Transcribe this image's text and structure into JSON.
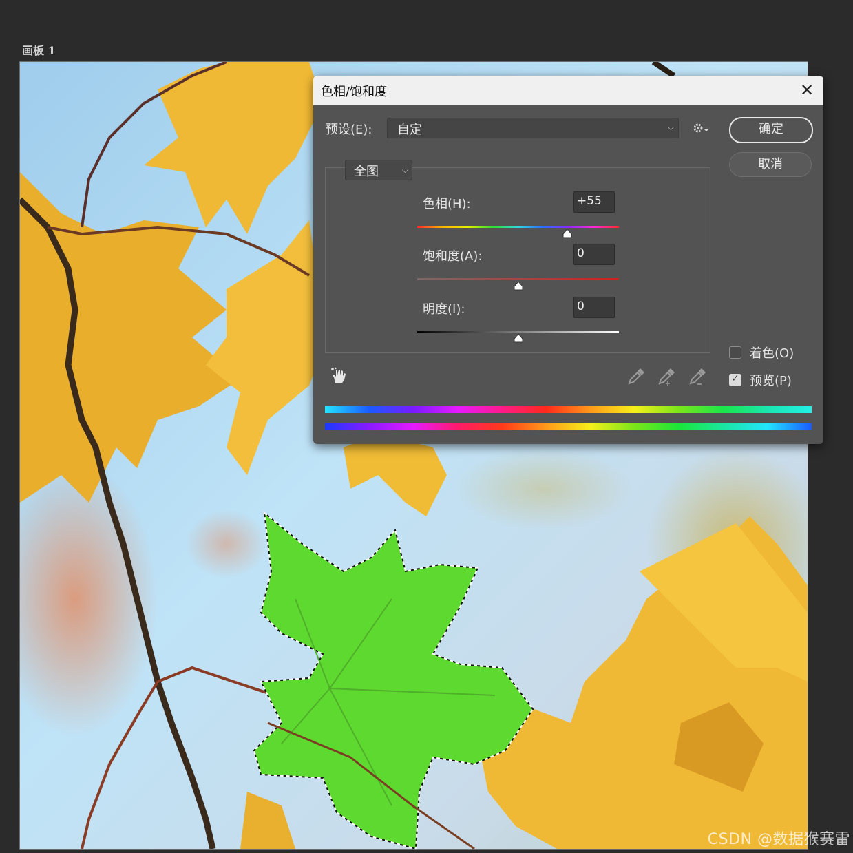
{
  "artboard": {
    "label": "画板 1"
  },
  "watermark": "CSDN @数据猴赛雷",
  "dialog": {
    "title": "色相/饱和度",
    "close_symbol": "✕",
    "preset": {
      "label": "预设(E):",
      "value": "自定"
    },
    "ok_label": "确定",
    "cancel_label": "取消",
    "channel": "全图",
    "adjustments": {
      "hue": {
        "label": "色相(H):",
        "value": "+55",
        "level": 55,
        "min": -180,
        "max": 180
      },
      "saturation": {
        "label": "饱和度(A):",
        "value": "0",
        "level": 0,
        "min": -100,
        "max": 100
      },
      "lightness": {
        "label": "明度(I):",
        "value": "0",
        "level": 0,
        "min": -100,
        "max": 100
      }
    },
    "colorize": {
      "label": "着色(O)",
      "checked": false
    },
    "preview": {
      "label": "预览(P)",
      "checked": true
    },
    "icons": {
      "target_adjust": "hand-target-icon",
      "eyedropper": "eyedropper-icon",
      "eyedropper_add": "eyedropper-plus-icon",
      "eyedropper_subtract": "eyedropper-minus-icon",
      "settings": "gear-icon"
    }
  },
  "colors": {
    "leaf_yellow": "#f0b935",
    "leaf_green": "#5ed92f",
    "sky": "#b8dff5",
    "dialog_bg": "#535353"
  }
}
